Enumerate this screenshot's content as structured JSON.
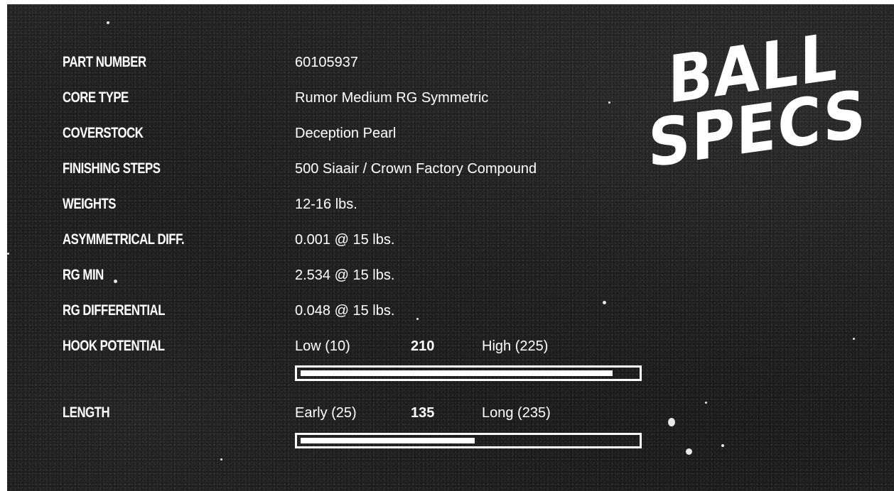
{
  "logo": {
    "line1": "BALL",
    "line2": "SPECS"
  },
  "specs": [
    {
      "label": "PART NUMBER",
      "value": "60105937"
    },
    {
      "label": "CORE TYPE",
      "value": "Rumor Medium RG Symmetric"
    },
    {
      "label": "COVERSTOCK",
      "value": "Deception Pearl"
    },
    {
      "label": "FINISHING STEPS",
      "value": "500 Siaair / Crown Factory Compound"
    },
    {
      "label": "WEIGHTS",
      "value": "12-16 lbs."
    },
    {
      "label": "ASYMMETRICAL DIFF.",
      "value": "0.001 @ 15 lbs."
    },
    {
      "label": "RG MIN",
      "value": "2.534 @ 15 lbs."
    },
    {
      "label": "RG DIFFERENTIAL",
      "value": "0.048 @ 15 lbs."
    }
  ],
  "hook": {
    "label": "HOOK POTENTIAL",
    "low": "Low (10)",
    "value": "210",
    "high": "High (225)",
    "fill_fraction": 0.93
  },
  "length": {
    "label": "LENGTH",
    "low": "Early (25)",
    "value": "135",
    "high": "Long (235)",
    "fill_fraction": 0.52
  },
  "colors": {
    "background": "#1c1c1c",
    "text": "#ffffff"
  }
}
